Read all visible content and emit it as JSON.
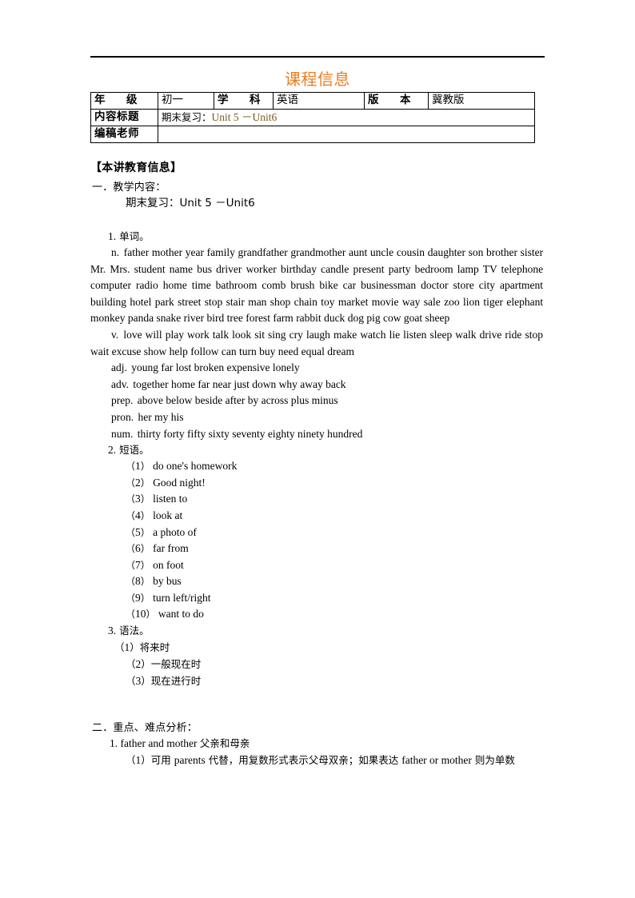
{
  "document": {
    "title": "课程信息",
    "title_color": "#ED7D20",
    "unit_value_color": "#7A5B1E"
  },
  "info_table": {
    "rows": [
      {
        "cells": [
          {
            "label_a": "年",
            "label_b": "级",
            "type": "label-spread"
          },
          {
            "value": "初一",
            "type": "value-cn"
          },
          {
            "label_a": "学",
            "label_b": "科",
            "type": "label-spread"
          },
          {
            "value": "英语",
            "type": "value-cn"
          },
          {
            "label_a": "版",
            "label_b": "本",
            "type": "label-spread"
          },
          {
            "value": "冀教版",
            "type": "value-cn"
          }
        ]
      },
      {
        "cells": [
          {
            "label": "内容标题",
            "type": "label"
          },
          {
            "value_cn": "期末复习：",
            "value_en": "Unit 5 －Unit6",
            "type": "value-mixed"
          }
        ]
      },
      {
        "cells": [
          {
            "label": "编稿老师",
            "type": "label"
          },
          {
            "value": "",
            "type": "value-cn"
          }
        ]
      }
    ]
  },
  "sections": {
    "teaching_info_heading": "【本讲教育信息】",
    "section1": {
      "number": "一．",
      "title": "教学内容：",
      "content_line": "期末复习：Unit 5 －Unit6",
      "items": [
        {
          "number": "1.",
          "title": "单词。",
          "word_groups": [
            {
              "pos": "n.",
              "first_line_indent": true,
              "words": [
                "father",
                "mother",
                "year",
                "family",
                "grandfather",
                "grandmother",
                "aunt",
                "uncle",
                "cousin",
                "daughter",
                "son",
                "brother",
                "sister",
                "Mr.",
                "Mrs.",
                "student",
                "name",
                "bus",
                "driver",
                "worker",
                "birthday",
                "candle",
                "present",
                "party",
                "bedroom",
                "lamp",
                "TV",
                "telephone",
                "computer",
                "radio",
                "home",
                "time",
                "bathroom",
                "comb",
                "brush",
                "bike",
                "car",
                "businessman",
                "doctor",
                "store",
                "city",
                "apartment",
                "building",
                "hotel",
                "park",
                "street",
                "stop",
                "stair",
                "man",
                "shop",
                "chain",
                "toy",
                "market",
                "movie",
                "way",
                "sale",
                "zoo",
                "lion",
                "tiger",
                "elephant",
                "monkey",
                "panda",
                "snake",
                "river",
                "bird",
                "tree",
                "forest",
                "farm",
                "rabbit",
                "duck",
                "dog",
                "pig",
                "cow",
                "goat",
                "sheep"
              ]
            },
            {
              "pos": "v.",
              "first_line_indent": true,
              "words": [
                "love",
                "will",
                "play",
                "work",
                "talk",
                "look",
                "sit",
                "sing",
                "cry",
                "laugh",
                "make",
                "watch",
                "lie",
                "listen",
                "sleep",
                "walk",
                "drive",
                "ride",
                "stop",
                "wait",
                "excuse",
                "show",
                "help",
                "follow",
                "can",
                "turn",
                "buy",
                "need",
                "equal",
                "dream"
              ]
            },
            {
              "pos": "adj.",
              "first_line_indent": true,
              "words": [
                "young",
                "far",
                "lost",
                "broken",
                "expensive",
                "lonely"
              ]
            },
            {
              "pos": "adv.",
              "first_line_indent": true,
              "words": [
                "together",
                "home",
                "far",
                "near",
                "just",
                "down",
                "why",
                "away",
                "back"
              ]
            },
            {
              "pos": "prep.",
              "first_line_indent": true,
              "words": [
                "above",
                "below",
                "beside",
                "after",
                "by",
                "across",
                "plus",
                "minus"
              ]
            },
            {
              "pos": "pron.",
              "first_line_indent": true,
              "words": [
                "her",
                "my",
                "his"
              ]
            },
            {
              "pos": "num.",
              "first_line_indent": true,
              "words": [
                "thirty",
                "forty",
                "fifty",
                "sixty",
                "seventy",
                "eighty",
                "ninety",
                "hundred"
              ]
            }
          ]
        },
        {
          "number": "2.",
          "title": "短语。",
          "phrases": [
            {
              "no": "1",
              "text": "do one's homework"
            },
            {
              "no": "2",
              "text": "Good night!"
            },
            {
              "no": "3",
              "text": "listen to"
            },
            {
              "no": "4",
              "text": "look at"
            },
            {
              "no": "5",
              "text": "a photo of"
            },
            {
              "no": "6",
              "text": "far from"
            },
            {
              "no": "7",
              "text": "on foot"
            },
            {
              "no": "8",
              "text": "by bus"
            },
            {
              "no": "9",
              "text": "turn left/right"
            },
            {
              "no": "10",
              "text": "want to do"
            }
          ]
        },
        {
          "number": "3.",
          "title": "语法。",
          "grammar": [
            {
              "no": "1",
              "text": "将来时",
              "tight": true
            },
            {
              "no": "2",
              "text": "一般现在时",
              "tight": false
            },
            {
              "no": "3",
              "text": "现在进行时",
              "tight": false
            }
          ]
        }
      ]
    },
    "section2": {
      "number": "二．",
      "title": "重点、难点分析：",
      "items": [
        {
          "number": "1.",
          "en": "father and mother",
          "cn": "父亲和母亲",
          "subs": [
            {
              "no": "1",
              "parts": [
                {
                  "t": "可用 ",
                  "k": "cn"
                },
                {
                  "t": "parents",
                  "k": "en"
                },
                {
                  "t": " 代替，用复数形式表示父母双亲；如果表达 ",
                  "k": "cn"
                },
                {
                  "t": "father or mother",
                  "k": "en"
                },
                {
                  "t": " 则为单数",
                  "k": "cn"
                }
              ]
            }
          ]
        }
      ]
    }
  }
}
